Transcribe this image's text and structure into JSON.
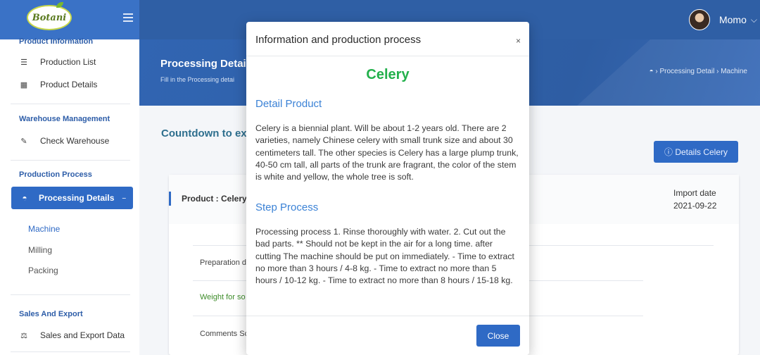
{
  "brand": {
    "logo_text": "Botani"
  },
  "user": {
    "name": "Momo"
  },
  "sidebar": {
    "sections": {
      "product_info": "Product Information",
      "warehouse": "Warehouse Management",
      "production": "Production Process",
      "sales": "Sales And Export"
    },
    "items": {
      "production_list": "Production List",
      "product_details": "Product Details",
      "check_warehouse": "Check Warehouse",
      "processing_details": "Processing Details",
      "sales_export": "Sales and Export Data"
    },
    "subitems": [
      "Machine",
      "Milling",
      "Packing"
    ]
  },
  "header": {
    "title": "Processing Detai",
    "subtitle": "Fill in the Processing detai",
    "breadcrumb": "› Processing Detail › Machine"
  },
  "content": {
    "countdown": "Countdown to ex",
    "details_button": "ⓘ Details Celery",
    "product": "Product : Celery",
    "import_label": "Import date",
    "import_date": "2021-09-22",
    "rows": [
      "Preparation d",
      "Weight for so",
      "Comments Sc"
    ]
  },
  "modal": {
    "title": "Information and production process",
    "close_x": "×",
    "product_name": "Celery",
    "detail_heading": "Detail Product",
    "detail_text": "Celery is a biennial plant. Will be about 1-2 years old. There are 2 varieties, namely Chinese celery with small trunk size and about 30 centimeters tall. The other species is Celery has a large plump trunk, 40-50 cm tall, all parts of the trunk are fragrant, the color of the stem is white and yellow, the whole tree is soft.",
    "step_heading": "Step Process",
    "step_text": "Processing process 1. Rinse thoroughly with water. 2. Cut out the bad parts. ** Should not be kept in the air for a long time. after cutting The machine should be put on immediately. - Time to extract no more than 3 hours / 4-8 kg. - Time to extract no more than 5 hours / 10-12 kg. - Time to extract no more than 8 hours / 15-18 kg.",
    "close_button": "Close"
  }
}
